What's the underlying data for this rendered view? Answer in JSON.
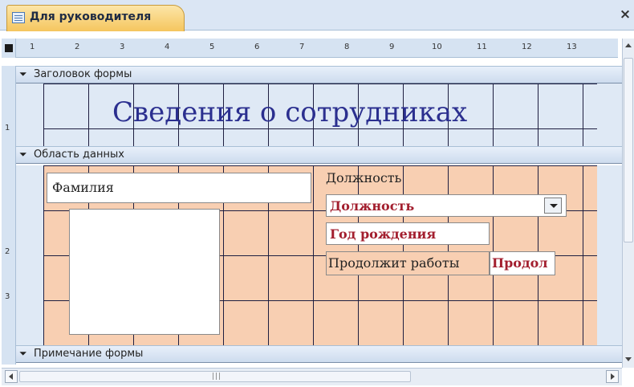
{
  "tab": {
    "title": "Для руководителя",
    "close_glyph": "×"
  },
  "ruler": {
    "horizontal": [
      "1",
      "2",
      "3",
      "4",
      "5",
      "6",
      "7",
      "8",
      "9",
      "10",
      "11",
      "12",
      "13"
    ],
    "vertical": [
      "1",
      "2",
      "3"
    ]
  },
  "sections": {
    "header": "Заголовок формы",
    "detail": "Область данных",
    "footer": "Примечание формы",
    "collapse_glyph": "⏷"
  },
  "form_title": "Сведения о сотрудниках",
  "controls": {
    "surname": "Фамилия",
    "position_label": "Должность",
    "position_combo": "Должность",
    "birth_year": "Год рождения",
    "continue_label": "Продолжит работы",
    "continue_field": "Продол"
  },
  "scrollbar": {
    "grip": "|||"
  },
  "colors": {
    "grid_fill": "#f8cfb2",
    "grid_line": "#1e1e40",
    "title": "#2b2f8f",
    "bound_text": "#a31f2f",
    "tab": "#f5c65e"
  }
}
